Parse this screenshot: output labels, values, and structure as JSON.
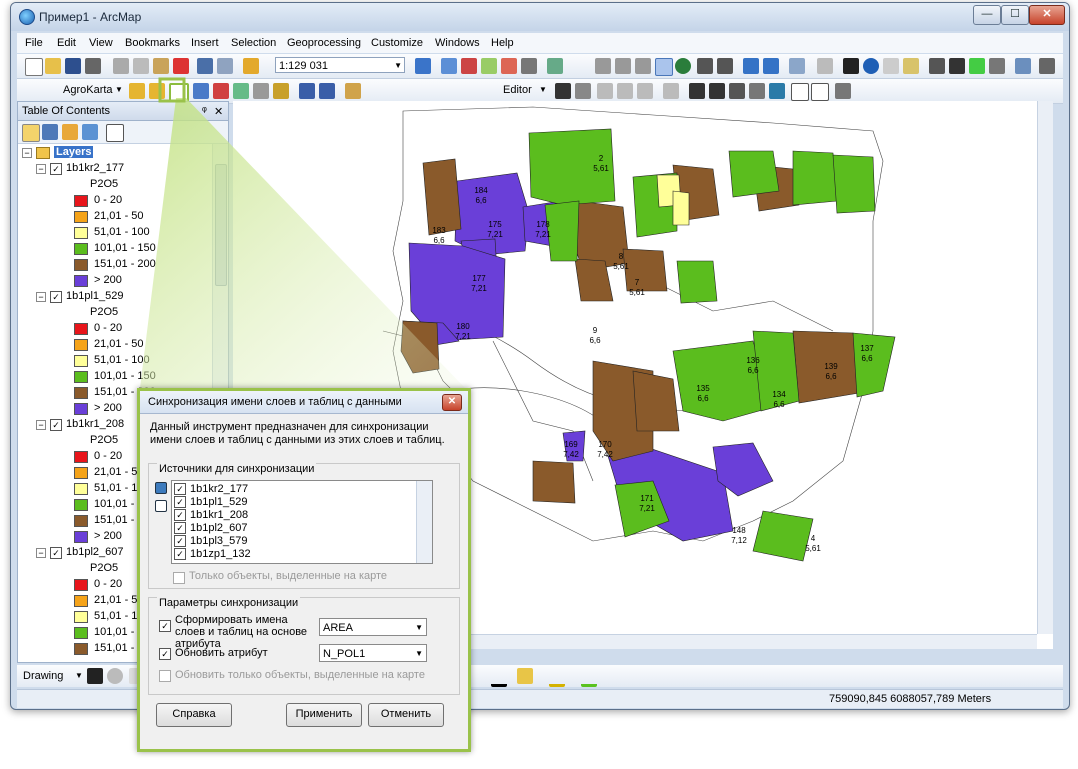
{
  "window": {
    "title": "Пример1 - ArcMap",
    "min": "—",
    "max": "☐",
    "close": "✕"
  },
  "menu": [
    "File",
    "Edit",
    "View",
    "Bookmarks",
    "Insert",
    "Selection",
    "Geoprocessing",
    "Customize",
    "Windows",
    "Help"
  ],
  "toolbar": {
    "scale": "1:129 031",
    "agrokarta": "AgroKarta",
    "editor": "Editor",
    "drawing": "Drawing"
  },
  "toc": {
    "title": "Table Of Contents",
    "root": "Layers",
    "field": "P2O5",
    "layers": [
      "1b1kr2_177",
      "1b1pl1_529",
      "1b1kr1_208",
      "1b1pl2_607"
    ],
    "classes": [
      "0 - 20",
      "21,01 - 50",
      "51,01 - 100",
      "101,01 - 150",
      "151,01 - 200",
      "> 200"
    ],
    "classes_truncated": [
      "0 - 20",
      "21,01 - 50",
      "51,01 - 100",
      "101,01 - 150",
      "151,01 - 200",
      "> 200"
    ],
    "class_colors": [
      "#e8151b",
      "#f5a319",
      "#ffff99",
      "#5bbd1e",
      "#8a5a2b",
      "#6a3fd8"
    ]
  },
  "status": {
    "coords": "759090,845  6088057,789 Meters"
  },
  "map_labels": [
    {
      "id": "184",
      "val": "6,6"
    },
    {
      "id": "175",
      "val": "7,21"
    },
    {
      "id": "178",
      "val": "7,21"
    },
    {
      "id": "183",
      "val": "6,6"
    },
    {
      "id": "177",
      "val": "7,21"
    },
    {
      "id": "180",
      "val": "7,21"
    },
    {
      "id": "2",
      "val": "5,61"
    },
    {
      "id": "8",
      "val": "5,61"
    },
    {
      "id": "7",
      "val": "5,61"
    },
    {
      "id": "9",
      "val": "6,6"
    },
    {
      "id": "139",
      "val": "6,6"
    },
    {
      "id": "135",
      "val": "6,6"
    },
    {
      "id": "137",
      "val": "6,6"
    },
    {
      "id": "171",
      "val": "7,21"
    },
    {
      "id": "148",
      "val": "7,12"
    },
    {
      "id": "4",
      "val": "5,61"
    },
    {
      "id": "169",
      "val": "7,42"
    },
    {
      "id": "170",
      "val": "7,42"
    },
    {
      "id": "134",
      "val": "6,6"
    },
    {
      "id": "136",
      "val": "6,6"
    }
  ],
  "dialog": {
    "title": "Синхронизация имени слоев и таблиц с данными",
    "close": "✕",
    "description": "Данный инструмент предназначен для синхронизации имени слоев и таблиц с данными из этих слоев и таблиц.",
    "sources_label": "Источники для синхронизации",
    "sources": [
      "1b1kr2_177",
      "1b1pl1_529",
      "1b1kr1_208",
      "1b1pl2_607",
      "1b1pl3_579",
      "1b1zp1_132"
    ],
    "only_selected": "Только объекты, выделенные на карте",
    "params_label": "Параметры синхронизации",
    "form_names": "Сформировать имена слоев и таблиц на основе атрибута",
    "form_names_value": "AREA",
    "update_attr": "Обновить атрибут",
    "update_attr_value": "N_POL1",
    "update_selected": "Обновить только объекты, выделенные на карте",
    "help": "Справка",
    "apply": "Применить",
    "cancel": "Отменить"
  }
}
